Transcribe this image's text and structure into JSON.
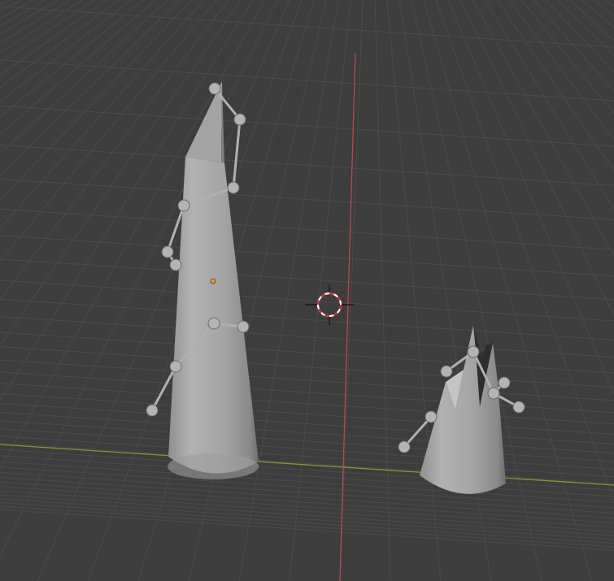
{
  "viewport": {
    "background": "#3d3d3d",
    "grid_color": "#4a4a4a",
    "x_axis_color": "#c2424f",
    "y_axis_color": "#7aa12a",
    "mesh_color": "#a8a8a8",
    "bone_color": "#b4b4b4",
    "origin_color": "#f39a1c"
  },
  "objects": [
    {
      "name": "tall-cone",
      "type": "mesh"
    },
    {
      "name": "short-cone",
      "type": "mesh"
    },
    {
      "name": "armature-tall",
      "type": "armature"
    },
    {
      "name": "armature-short",
      "type": "armature"
    }
  ],
  "icons": [
    "3d-cursor-icon",
    "origin-dot-icon"
  ]
}
